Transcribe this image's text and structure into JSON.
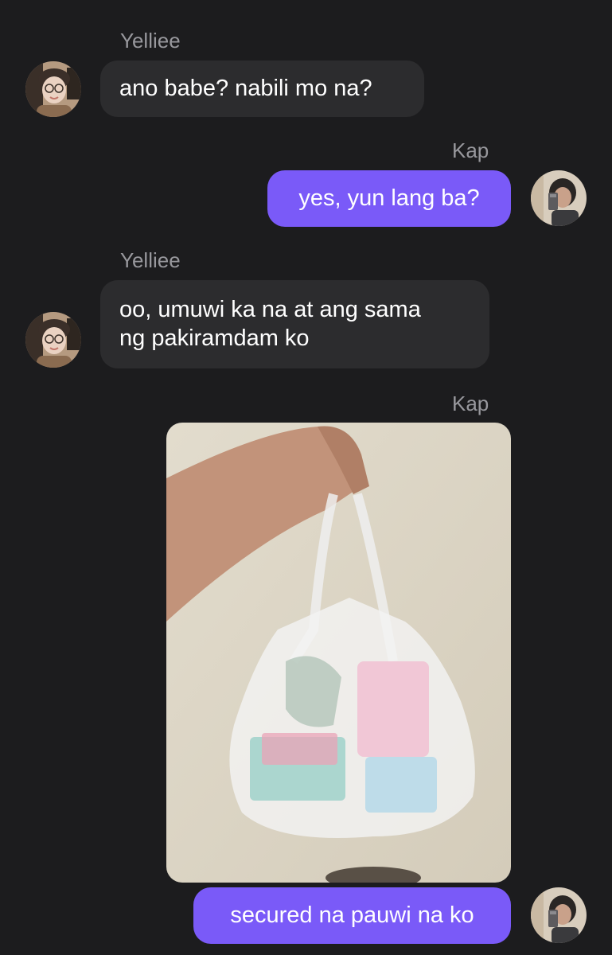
{
  "messages": [
    {
      "sender": "Yelliee",
      "direction": "incoming",
      "text": "ano babe? nabili mo na?"
    },
    {
      "sender": "Kap",
      "direction": "outgoing",
      "text": "yes, yun lang ba?"
    },
    {
      "sender": "Yelliee",
      "direction": "incoming",
      "text": "oo, umuwi ka na at ang sama\nng pakiramdam ko"
    },
    {
      "sender": "Kap",
      "direction": "outgoing",
      "attachment": "photo-of-plastic-bag"
    },
    {
      "direction": "outgoing",
      "text": "secured na pauwi na ko"
    }
  ],
  "colors": {
    "background": "#1c1c1e",
    "incoming_bubble": "#2c2c2e",
    "outgoing_bubble": "#7a5af8",
    "sender_label": "#98989d",
    "text": "#ffffff"
  }
}
